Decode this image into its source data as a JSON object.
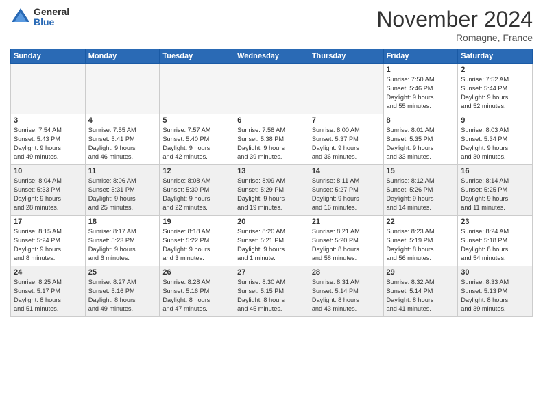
{
  "header": {
    "logo_general": "General",
    "logo_blue": "Blue",
    "month_title": "November 2024",
    "subtitle": "Romagne, France"
  },
  "days_of_week": [
    "Sunday",
    "Monday",
    "Tuesday",
    "Wednesday",
    "Thursday",
    "Friday",
    "Saturday"
  ],
  "weeks": [
    [
      {
        "day": "",
        "info": "",
        "empty": true
      },
      {
        "day": "",
        "info": "",
        "empty": true
      },
      {
        "day": "",
        "info": "",
        "empty": true
      },
      {
        "day": "",
        "info": "",
        "empty": true
      },
      {
        "day": "",
        "info": "",
        "empty": true
      },
      {
        "day": "1",
        "info": "Sunrise: 7:50 AM\nSunset: 5:46 PM\nDaylight: 9 hours\nand 55 minutes.",
        "empty": false
      },
      {
        "day": "2",
        "info": "Sunrise: 7:52 AM\nSunset: 5:44 PM\nDaylight: 9 hours\nand 52 minutes.",
        "empty": false
      }
    ],
    [
      {
        "day": "3",
        "info": "Sunrise: 7:54 AM\nSunset: 5:43 PM\nDaylight: 9 hours\nand 49 minutes.",
        "empty": false
      },
      {
        "day": "4",
        "info": "Sunrise: 7:55 AM\nSunset: 5:41 PM\nDaylight: 9 hours\nand 46 minutes.",
        "empty": false
      },
      {
        "day": "5",
        "info": "Sunrise: 7:57 AM\nSunset: 5:40 PM\nDaylight: 9 hours\nand 42 minutes.",
        "empty": false
      },
      {
        "day": "6",
        "info": "Sunrise: 7:58 AM\nSunset: 5:38 PM\nDaylight: 9 hours\nand 39 minutes.",
        "empty": false
      },
      {
        "day": "7",
        "info": "Sunrise: 8:00 AM\nSunset: 5:37 PM\nDaylight: 9 hours\nand 36 minutes.",
        "empty": false
      },
      {
        "day": "8",
        "info": "Sunrise: 8:01 AM\nSunset: 5:35 PM\nDaylight: 9 hours\nand 33 minutes.",
        "empty": false
      },
      {
        "day": "9",
        "info": "Sunrise: 8:03 AM\nSunset: 5:34 PM\nDaylight: 9 hours\nand 30 minutes.",
        "empty": false
      }
    ],
    [
      {
        "day": "10",
        "info": "Sunrise: 8:04 AM\nSunset: 5:33 PM\nDaylight: 9 hours\nand 28 minutes.",
        "empty": false
      },
      {
        "day": "11",
        "info": "Sunrise: 8:06 AM\nSunset: 5:31 PM\nDaylight: 9 hours\nand 25 minutes.",
        "empty": false
      },
      {
        "day": "12",
        "info": "Sunrise: 8:08 AM\nSunset: 5:30 PM\nDaylight: 9 hours\nand 22 minutes.",
        "empty": false
      },
      {
        "day": "13",
        "info": "Sunrise: 8:09 AM\nSunset: 5:29 PM\nDaylight: 9 hours\nand 19 minutes.",
        "empty": false
      },
      {
        "day": "14",
        "info": "Sunrise: 8:11 AM\nSunset: 5:27 PM\nDaylight: 9 hours\nand 16 minutes.",
        "empty": false
      },
      {
        "day": "15",
        "info": "Sunrise: 8:12 AM\nSunset: 5:26 PM\nDaylight: 9 hours\nand 14 minutes.",
        "empty": false
      },
      {
        "day": "16",
        "info": "Sunrise: 8:14 AM\nSunset: 5:25 PM\nDaylight: 9 hours\nand 11 minutes.",
        "empty": false
      }
    ],
    [
      {
        "day": "17",
        "info": "Sunrise: 8:15 AM\nSunset: 5:24 PM\nDaylight: 9 hours\nand 8 minutes.",
        "empty": false
      },
      {
        "day": "18",
        "info": "Sunrise: 8:17 AM\nSunset: 5:23 PM\nDaylight: 9 hours\nand 6 minutes.",
        "empty": false
      },
      {
        "day": "19",
        "info": "Sunrise: 8:18 AM\nSunset: 5:22 PM\nDaylight: 9 hours\nand 3 minutes.",
        "empty": false
      },
      {
        "day": "20",
        "info": "Sunrise: 8:20 AM\nSunset: 5:21 PM\nDaylight: 9 hours\nand 1 minute.",
        "empty": false
      },
      {
        "day": "21",
        "info": "Sunrise: 8:21 AM\nSunset: 5:20 PM\nDaylight: 8 hours\nand 58 minutes.",
        "empty": false
      },
      {
        "day": "22",
        "info": "Sunrise: 8:23 AM\nSunset: 5:19 PM\nDaylight: 8 hours\nand 56 minutes.",
        "empty": false
      },
      {
        "day": "23",
        "info": "Sunrise: 8:24 AM\nSunset: 5:18 PM\nDaylight: 8 hours\nand 54 minutes.",
        "empty": false
      }
    ],
    [
      {
        "day": "24",
        "info": "Sunrise: 8:25 AM\nSunset: 5:17 PM\nDaylight: 8 hours\nand 51 minutes.",
        "empty": false
      },
      {
        "day": "25",
        "info": "Sunrise: 8:27 AM\nSunset: 5:16 PM\nDaylight: 8 hours\nand 49 minutes.",
        "empty": false
      },
      {
        "day": "26",
        "info": "Sunrise: 8:28 AM\nSunset: 5:16 PM\nDaylight: 8 hours\nand 47 minutes.",
        "empty": false
      },
      {
        "day": "27",
        "info": "Sunrise: 8:30 AM\nSunset: 5:15 PM\nDaylight: 8 hours\nand 45 minutes.",
        "empty": false
      },
      {
        "day": "28",
        "info": "Sunrise: 8:31 AM\nSunset: 5:14 PM\nDaylight: 8 hours\nand 43 minutes.",
        "empty": false
      },
      {
        "day": "29",
        "info": "Sunrise: 8:32 AM\nSunset: 5:14 PM\nDaylight: 8 hours\nand 41 minutes.",
        "empty": false
      },
      {
        "day": "30",
        "info": "Sunrise: 8:33 AM\nSunset: 5:13 PM\nDaylight: 8 hours\nand 39 minutes.",
        "empty": false
      }
    ]
  ]
}
